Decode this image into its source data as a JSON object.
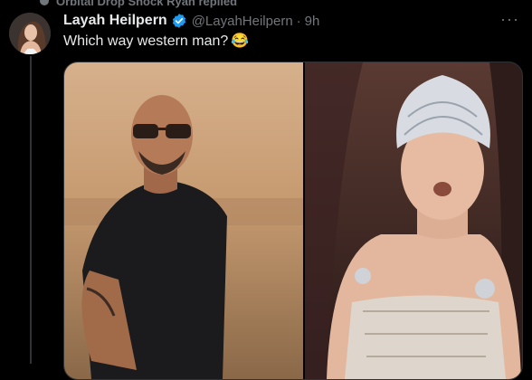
{
  "thread": {
    "reply_context": "Orbital Drop Shock Ryan replied"
  },
  "tweet": {
    "author_name": "Layah Heilpern",
    "handle": "@LayahHeilpern",
    "separator": "·",
    "timestamp": "9h",
    "text": "Which way western man?",
    "emoji": "😂",
    "more_glyph": "···"
  },
  "colors": {
    "background": "#000000",
    "primary_text": "#e7e9ea",
    "secondary_text": "#71767b",
    "verified_blue": "#1d9bf0",
    "border": "#2f3336"
  },
  "icons": {
    "verified": "verified-badge-icon",
    "more": "more-options-icon"
  }
}
